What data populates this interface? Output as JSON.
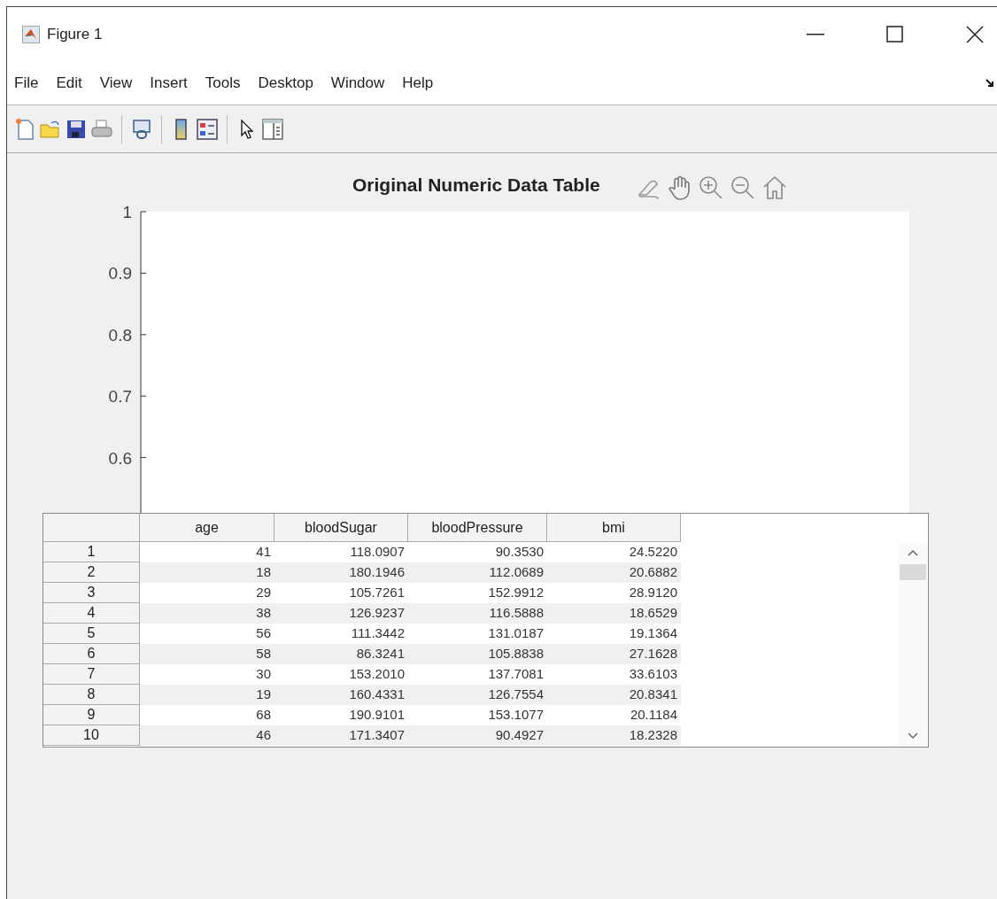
{
  "window": {
    "title": "Figure 1"
  },
  "menu": [
    "File",
    "Edit",
    "View",
    "Insert",
    "Tools",
    "Desktop",
    "Window",
    "Help"
  ],
  "axes": {
    "title": "Original Numeric Data Table",
    "y_tick_labels": [
      "1",
      "0.9",
      "0.8",
      "0.7",
      "0.6"
    ]
  },
  "table": {
    "columns": [
      "age",
      "bloodSugar",
      "bloodPressure",
      "bmi"
    ],
    "rows": [
      {
        "label": "1",
        "cells": [
          "41",
          "118.0907",
          "90.3530",
          "24.5220"
        ]
      },
      {
        "label": "2",
        "cells": [
          "18",
          "180.1946",
          "112.0689",
          "20.6882"
        ]
      },
      {
        "label": "3",
        "cells": [
          "29",
          "105.7261",
          "152.9912",
          "28.9120"
        ]
      },
      {
        "label": "4",
        "cells": [
          "38",
          "126.9237",
          "116.5888",
          "18.6529"
        ]
      },
      {
        "label": "5",
        "cells": [
          "56",
          "111.3442",
          "131.0187",
          "19.1364"
        ]
      },
      {
        "label": "6",
        "cells": [
          "58",
          "86.3241",
          "105.8838",
          "27.1628"
        ]
      },
      {
        "label": "7",
        "cells": [
          "30",
          "153.2010",
          "137.7081",
          "33.6103"
        ]
      },
      {
        "label": "8",
        "cells": [
          "19",
          "160.4331",
          "126.7554",
          "20.8341"
        ]
      },
      {
        "label": "9",
        "cells": [
          "68",
          "190.9101",
          "153.1077",
          "20.1184"
        ]
      },
      {
        "label": "10",
        "cells": [
          "46",
          "171.3407",
          "90.4927",
          "18.2328"
        ]
      }
    ]
  }
}
